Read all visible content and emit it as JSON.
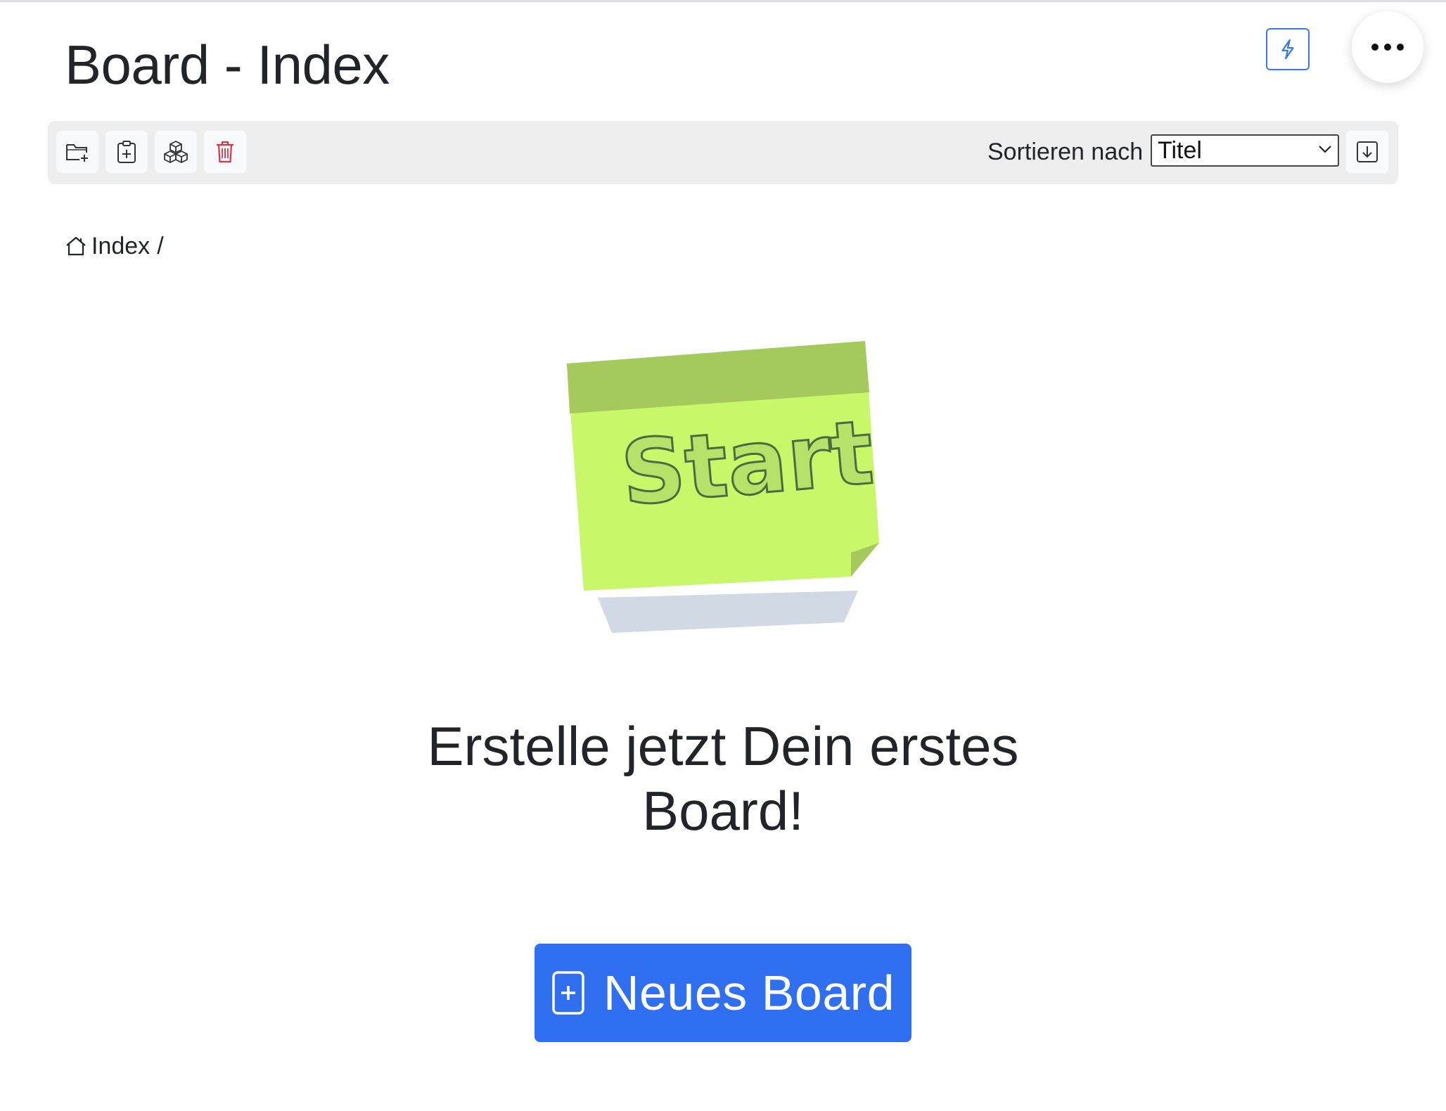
{
  "header": {
    "title": "Board - Index",
    "quick_action_icon": "lightning-icon",
    "more_icon": "ellipsis-icon"
  },
  "toolbar": {
    "buttons": [
      {
        "icon": "folder-plus-icon"
      },
      {
        "icon": "clipboard-plus-icon"
      },
      {
        "icon": "boxes-icon"
      },
      {
        "icon": "trash-icon",
        "color": "#dc3545"
      }
    ],
    "sort_label": "Sortieren nach",
    "sort_value": "Titel",
    "sort_direction_icon": "arrow-down-square-icon"
  },
  "breadcrumb": {
    "home_icon": "house-icon",
    "items": [
      {
        "label": "Index"
      }
    ],
    "separator": "/"
  },
  "empty_state": {
    "illustration_text": "Start",
    "headline": "Erstelle jetzt Dein erstes Board!",
    "button_label": "Neues Board",
    "button_icon": "file-plus-icon"
  },
  "colors": {
    "primary": "#2f6ff0",
    "danger": "#dc3545",
    "note_green": "#c8f76a",
    "note_header": "#a5c95c",
    "shadow": "#d0d9e4",
    "toolbar_bg": "#eeeeee"
  }
}
